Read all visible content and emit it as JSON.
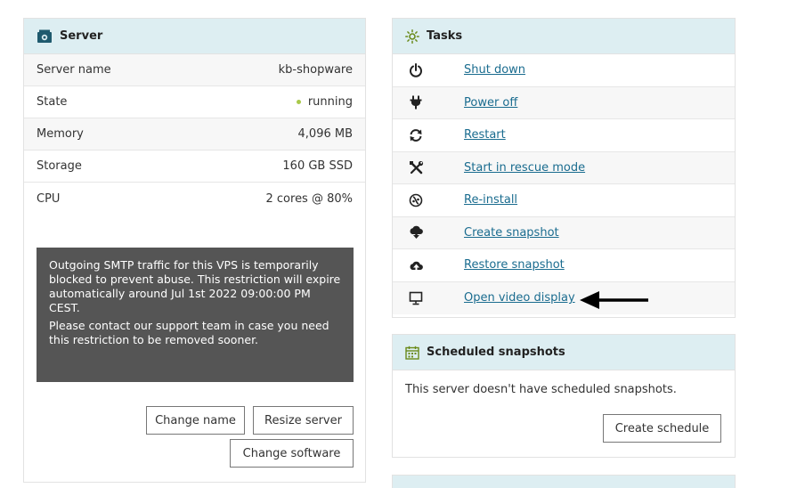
{
  "server": {
    "title": "Server",
    "rows": [
      {
        "label": "Server name",
        "value": "kb-shopware"
      },
      {
        "label": "State",
        "value": "running"
      },
      {
        "label": "Memory",
        "value": "4,096 MB"
      },
      {
        "label": "Storage",
        "value": "160 GB SSD"
      },
      {
        "label": "CPU",
        "value": "2 cores @ 80%"
      }
    ],
    "state_color": "#a9c94a",
    "notice": {
      "line1": "Outgoing SMTP traffic for this VPS is temporarily blocked to prevent abuse. This restriction will expire automatically around Jul 1st 2022 09:00:00 PM CEST.",
      "line2": "Please contact our support team in case you need this restriction to be removed sooner."
    },
    "buttons": {
      "change_name": "Change name",
      "resize_server": "Resize server",
      "change_software": "Change software"
    }
  },
  "tasks": {
    "title": "Tasks",
    "items": [
      {
        "label": "Shut down",
        "icon": "power-icon"
      },
      {
        "label": "Power off",
        "icon": "plug-icon"
      },
      {
        "label": "Restart",
        "icon": "restart-icon"
      },
      {
        "label": "Start in rescue mode",
        "icon": "tools-icon"
      },
      {
        "label": "Re-install",
        "icon": "reinstall-icon"
      },
      {
        "label": "Create snapshot",
        "icon": "cloud-download-icon"
      },
      {
        "label": "Restore snapshot",
        "icon": "cloud-upload-icon"
      },
      {
        "label": "Open video display",
        "icon": "monitor-icon"
      }
    ]
  },
  "scheduled_snapshots": {
    "title": "Scheduled snapshots",
    "empty_text": "This server doesn't have scheduled snapshots.",
    "button": "Create schedule"
  },
  "colors": {
    "header_bg": "#ddeef2",
    "link": "#1a6c8f",
    "notice_bg": "#555555"
  }
}
